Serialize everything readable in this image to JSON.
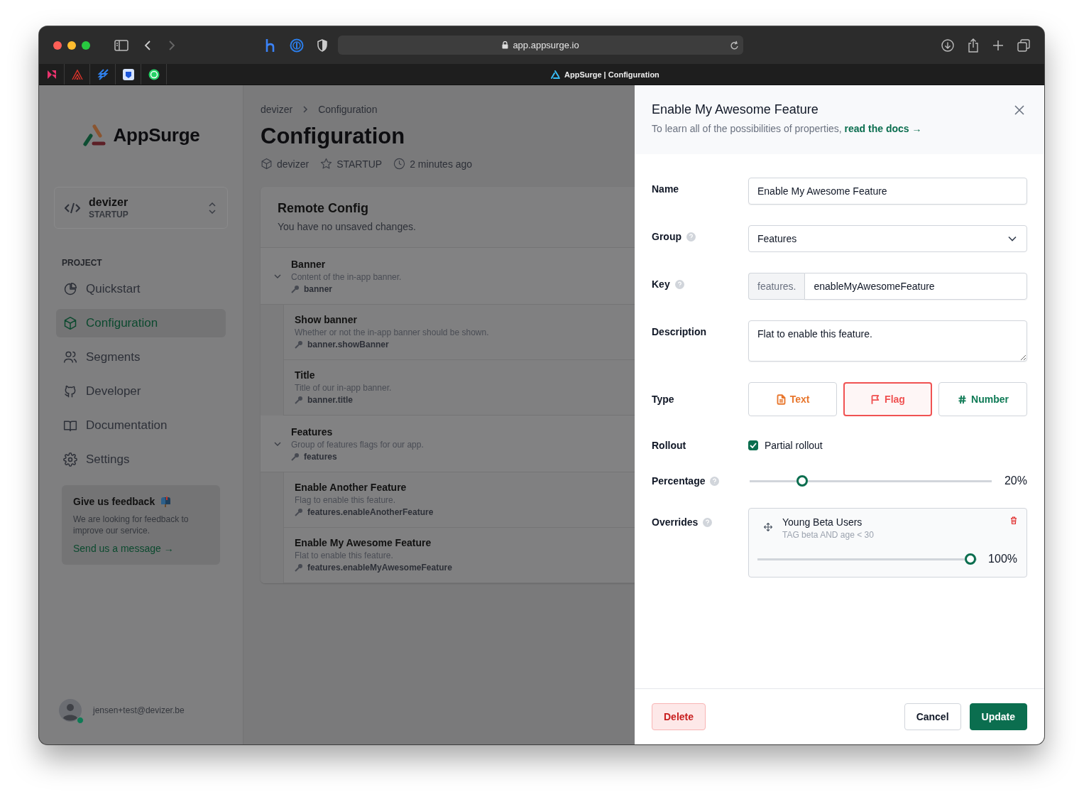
{
  "browser": {
    "url": "app.appsurge.io",
    "tab_title": "AppSurge | Configuration"
  },
  "sidebar": {
    "brand": "AppSurge",
    "workspace": {
      "name": "devizer",
      "plan": "STARTUP"
    },
    "section_label": "PROJECT",
    "nav": [
      {
        "label": "Quickstart",
        "selected": false
      },
      {
        "label": "Configuration",
        "selected": true
      },
      {
        "label": "Segments",
        "selected": false
      },
      {
        "label": "Developer",
        "selected": false
      },
      {
        "label": "Documentation",
        "selected": false
      },
      {
        "label": "Settings",
        "selected": false
      }
    ],
    "feedback": {
      "title": "Give us feedback",
      "body": "We are looking for feedback to improve our service.",
      "link": "Send us a message →"
    },
    "user": {
      "email": "jensen+test@devizer.be",
      "online": true
    }
  },
  "main": {
    "breadcrumb": [
      "devizer",
      "Configuration"
    ],
    "title": "Configuration",
    "meta": [
      "devizer",
      "STARTUP",
      "2 minutes ago"
    ],
    "card": {
      "title": "Remote Config",
      "subtitle": "You have no unsaved changes.",
      "groups": [
        {
          "name": "Banner",
          "description": "Content of the in-app banner.",
          "key": "banner",
          "expanded": true,
          "children": [
            {
              "name": "Show banner",
              "description": "Whether or not the in-app banner should be shown.",
              "key": "banner.showBanner"
            },
            {
              "name": "Title",
              "description": "Title of our in-app banner.",
              "key": "banner.title"
            }
          ]
        },
        {
          "name": "Features",
          "description": "Group of features flags for our app.",
          "key": "features",
          "expanded": true,
          "children": [
            {
              "name": "Enable Another Feature",
              "description": "Flag to enable this feature.",
              "key": "features.enableAnotherFeature"
            },
            {
              "name": "Enable My Awesome Feature",
              "description": "Flat to enable this feature.",
              "key": "features.enableMyAwesomeFeature"
            }
          ]
        }
      ]
    }
  },
  "panel": {
    "title": "Enable My Awesome Feature",
    "intro": "To learn all of the possibilities of properties,",
    "intro_link": "read the docs →",
    "name": {
      "label": "Name",
      "value": "Enable My Awesome Feature"
    },
    "group": {
      "label": "Group",
      "value": "Features"
    },
    "key": {
      "label": "Key",
      "prefix": "features.",
      "value": "enableMyAwesomeFeature"
    },
    "description": {
      "label": "Description",
      "value": "Flat to enable this feature."
    },
    "type": {
      "label": "Type",
      "options": [
        {
          "label": "Text",
          "selected": false,
          "color": "#e8772e"
        },
        {
          "label": "Flag",
          "selected": true,
          "color": "#f05252"
        },
        {
          "label": "Number",
          "selected": false,
          "color": "#0e7a55"
        }
      ]
    },
    "rollout": {
      "label": "Rollout",
      "option": "Partial rollout",
      "checked": true
    },
    "percentage": {
      "label": "Percentage",
      "level": 0.2,
      "reading": "20%"
    },
    "overrides": {
      "label": "Overrides",
      "items": [
        {
          "name": "Young Beta Users",
          "rule": "TAG beta AND age < 30",
          "level": 1,
          "reading": "100%"
        }
      ]
    },
    "buttons": {
      "delete": "Delete",
      "cancel": "Cancel",
      "update": "Update"
    }
  }
}
